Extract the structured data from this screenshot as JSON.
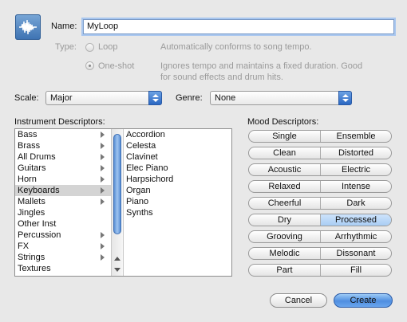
{
  "header": {
    "app_icon": "waveform-icon",
    "name_label": "Name:",
    "name_value": "MyLoop"
  },
  "type": {
    "label": "Type:",
    "options": [
      {
        "label": "Loop",
        "description": "Automatically conforms to song tempo.",
        "selected": false
      },
      {
        "label": "One-shot",
        "description_line1": "Ignores tempo and maintains a fixed duration. Good",
        "description_line2": "for sound effects and drum hits.",
        "selected": true
      }
    ]
  },
  "scale": {
    "label": "Scale:",
    "value": "Major"
  },
  "genre": {
    "label": "Genre:",
    "value": "None"
  },
  "instrument": {
    "label": "Instrument Descriptors:",
    "categories": [
      {
        "label": "Bass",
        "has_children": true
      },
      {
        "label": "Brass",
        "has_children": true
      },
      {
        "label": "All Drums",
        "has_children": true
      },
      {
        "label": "Guitars",
        "has_children": true
      },
      {
        "label": "Horn",
        "has_children": true
      },
      {
        "label": "Keyboards",
        "has_children": true,
        "selected": true
      },
      {
        "label": "Mallets",
        "has_children": true
      },
      {
        "label": "Jingles",
        "has_children": false
      },
      {
        "label": "Other Inst",
        "has_children": false
      },
      {
        "label": "Percussion",
        "has_children": true
      },
      {
        "label": "FX",
        "has_children": true
      },
      {
        "label": "Strings",
        "has_children": true
      },
      {
        "label": "Textures",
        "has_children": false
      }
    ],
    "subitems": [
      "Accordion",
      "Celesta",
      "Clavinet",
      "Elec Piano",
      "Harpsichord",
      "Organ",
      "Piano",
      "Synths"
    ]
  },
  "mood": {
    "label": "Mood Descriptors:",
    "pairs": [
      {
        "left": "Single",
        "right": "Ensemble",
        "selected": ""
      },
      {
        "left": "Clean",
        "right": "Distorted",
        "selected": ""
      },
      {
        "left": "Acoustic",
        "right": "Electric",
        "selected": ""
      },
      {
        "left": "Relaxed",
        "right": "Intense",
        "selected": ""
      },
      {
        "left": "Cheerful",
        "right": "Dark",
        "selected": ""
      },
      {
        "left": "Dry",
        "right": "Processed",
        "selected": "right"
      },
      {
        "left": "Grooving",
        "right": "Arrhythmic",
        "selected": ""
      },
      {
        "left": "Melodic",
        "right": "Dissonant",
        "selected": ""
      },
      {
        "left": "Part",
        "right": "Fill",
        "selected": ""
      }
    ]
  },
  "footer": {
    "cancel_label": "Cancel",
    "create_label": "Create"
  },
  "colors": {
    "accent": "#4f8ee0",
    "selection": "#a9cdf4"
  }
}
